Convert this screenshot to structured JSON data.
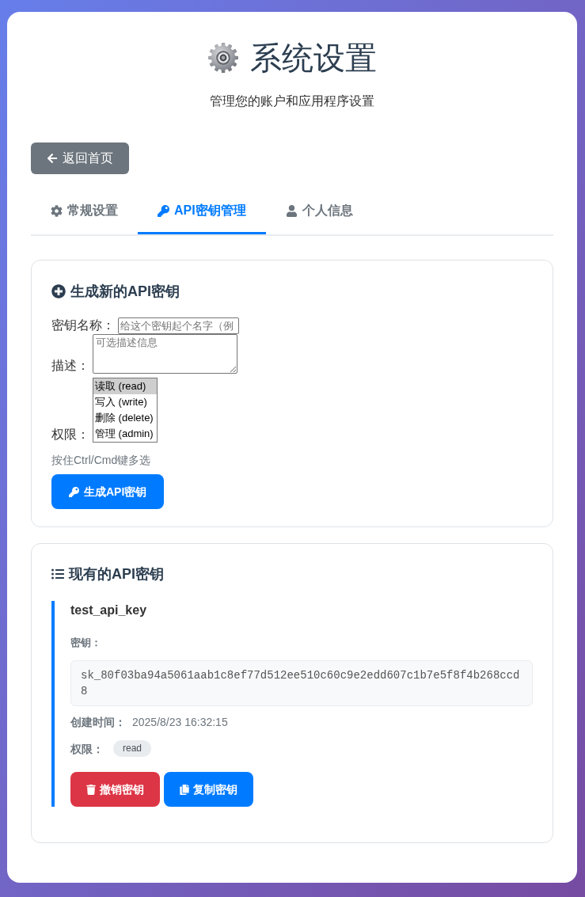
{
  "header": {
    "title": "系统设置",
    "subtitle": "管理您的账户和应用程序设置"
  },
  "back_button": {
    "label": "返回首页"
  },
  "tabs": [
    {
      "label": "常规设置",
      "selected": false
    },
    {
      "label": "API密钥管理",
      "selected": true
    },
    {
      "label": "个人信息",
      "selected": false
    }
  ],
  "generate_form": {
    "title": "生成新的API密钥",
    "fields": [
      {
        "kind": "text",
        "label": "密钥名称：",
        "placeholder": "给这个密钥起个名字（例"
      },
      {
        "kind": "textarea",
        "label": "描述：",
        "placeholder": "可选描述信息"
      },
      {
        "kind": "multiselect",
        "label": "权限：",
        "options": [
          {
            "label": "读取 (read)",
            "selected": true
          },
          {
            "label": "写入 (write)",
            "selected": false
          },
          {
            "label": "删除 (delete)",
            "selected": false
          },
          {
            "label": "管理 (admin)",
            "selected": false
          }
        ]
      }
    ],
    "hint": "按住Ctrl/Cmd键多选",
    "submit_button": "生成API密钥"
  },
  "key_list": {
    "title": "现有的API密钥",
    "keys": [
      {
        "name": "test_api_key",
        "key_label": "密钥：",
        "key": "sk_80f03ba94a5061aab1c8ef77d512ee510c60c9e2edd607c1b7e5f8f4b268ccd8",
        "created_label": "创建时间：",
        "created": "2025/8/23 16:32:15",
        "permissions_label": "权限：",
        "permissions": [
          "read"
        ],
        "buttons": [
          {
            "kind": "revoke",
            "label": "撤销密钥"
          },
          {
            "kind": "copy",
            "label": "复制密钥"
          }
        ]
      }
    ]
  }
}
